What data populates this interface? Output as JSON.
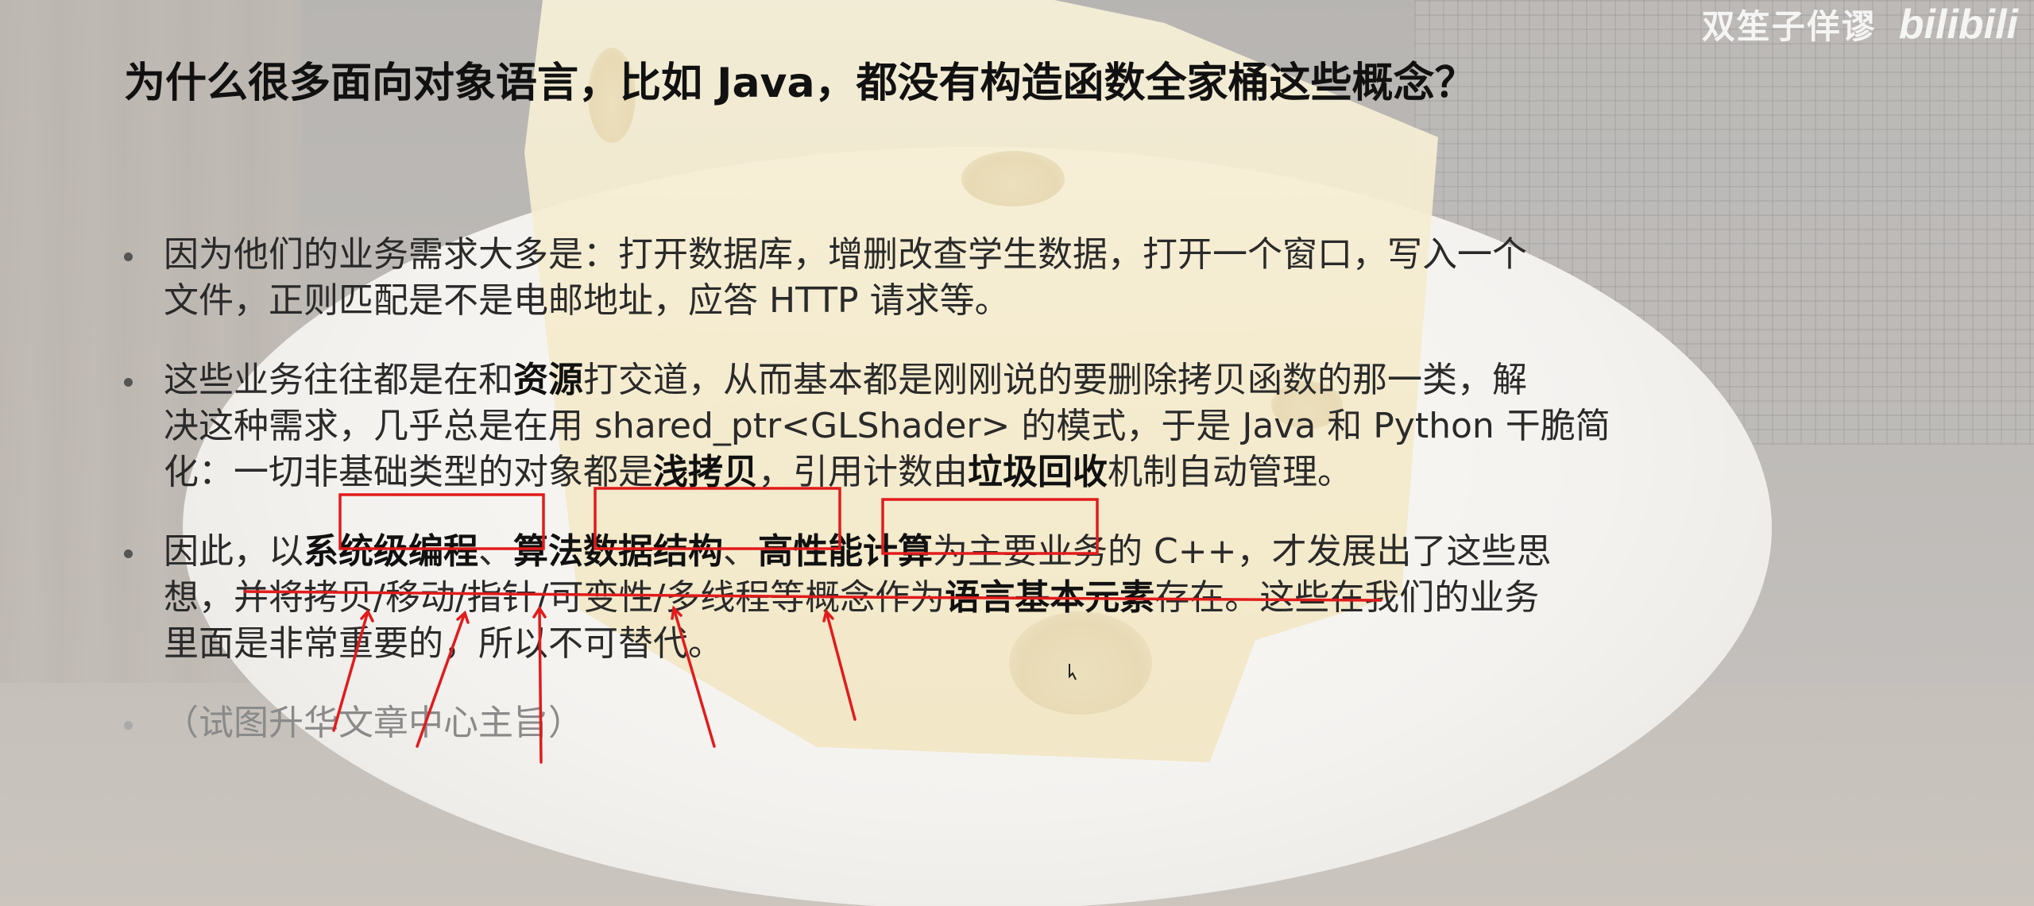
{
  "watermark": {
    "text": "双笙子佯谬",
    "logo": "bilibili"
  },
  "slide": {
    "title": "为什么很多面向对象语言，比如 Java，都没有构造函数全家桶这些概念？",
    "bullet1": {
      "line1": "因为他们的业务需求大多是：打开数据库，增删改查学生数据，打开一个窗口，写入一个",
      "line2": "文件，正则匹配是不是电邮地址，应答 HTTP 请求等。"
    },
    "bullet2": {
      "line1_a": "这些业务往往都是在和",
      "line1_b": "资源",
      "line1_c": "打交道，从而基本都是刚刚说的要删除拷贝函数的那一类，解",
      "line2": "决这种需求，几乎总是在用 shared_ptr<GLShader> 的模式，于是 Java 和 Python 干脆简",
      "line3_a": "化：一切非基础类型的对象都是",
      "line3_b": "浅拷贝",
      "line3_c": "，引用计数由",
      "line3_d": "垃圾回收",
      "line3_e": "机制自动管理。"
    },
    "bullet3": {
      "line1_a": "因此，以",
      "line1_b": "系统级编程",
      "line1_c": "、",
      "line1_d": "算法数据结构",
      "line1_e": "、",
      "line1_f": "高性能计算",
      "line1_g": "为主要业务的 C++，才发展出了这些思",
      "line2_a": "想，并将拷贝/移动/指针/可变性/多线程等概念作为",
      "line2_b": "语言基本元素",
      "line2_c": "存在。这些在我们的业务",
      "line3": "里面是非常重要的，所以不可替代。"
    },
    "bullet4": "（试图升华文章中心主旨）"
  },
  "colors": {
    "annotation_red": "#e21b1b",
    "title_text": "#111111",
    "body_text": "#2a2a2a",
    "muted_text": "#8a8a8a"
  }
}
